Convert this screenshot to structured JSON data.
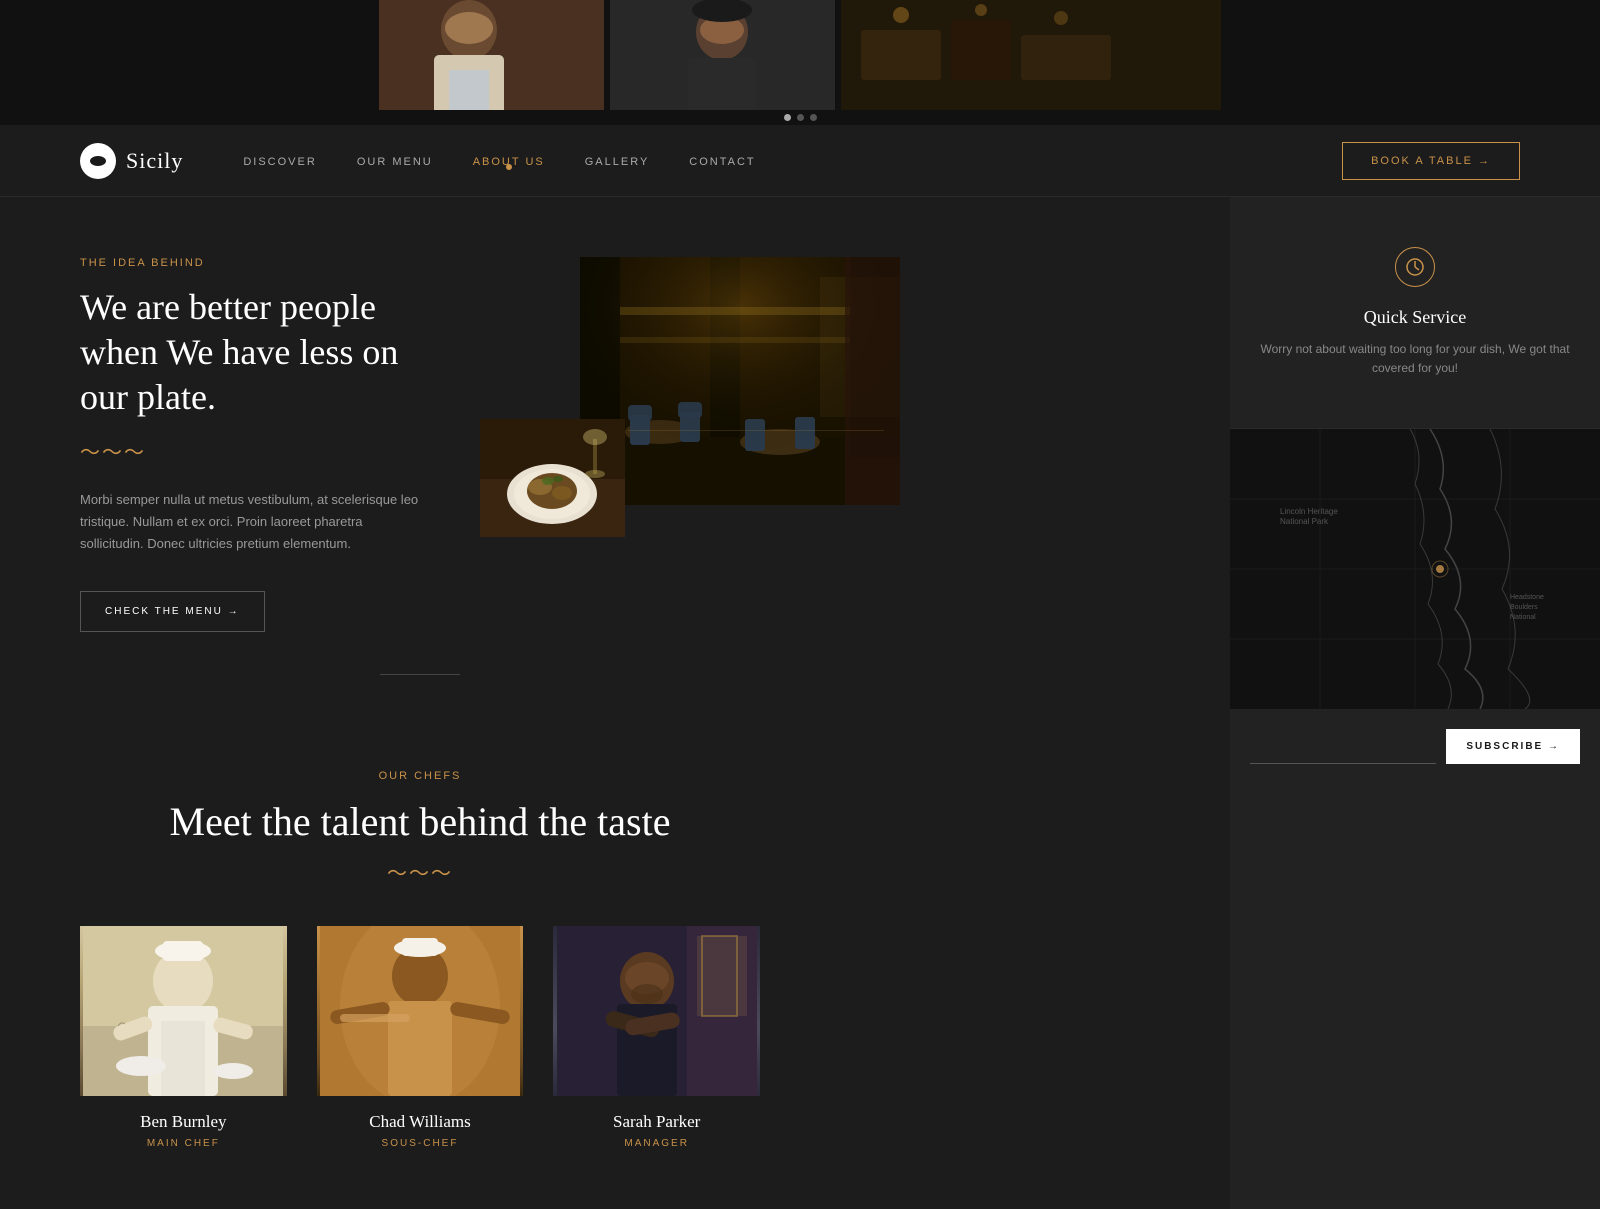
{
  "brand": {
    "logo_icon": "🥸",
    "name": "Sicily"
  },
  "hero": {
    "dots": [
      "active",
      "inactive",
      "inactive"
    ]
  },
  "nav": {
    "links": [
      {
        "id": "discover",
        "label": "DISCOVER",
        "active": false
      },
      {
        "id": "our-menu",
        "label": "OUR MENU",
        "active": false
      },
      {
        "id": "about-us",
        "label": "ABOUT US",
        "active": true
      },
      {
        "id": "gallery",
        "label": "GALLERY",
        "active": false
      },
      {
        "id": "contact",
        "label": "CONTACT",
        "active": false
      }
    ],
    "cta_label": "BOOK A TABLE →"
  },
  "about": {
    "section_label": "THE IDEA BEHIND",
    "headline": "We are better people when We have less on our plate.",
    "wave": "~~~",
    "body": "Morbi semper nulla ut metus vestibulum, at scelerisque leo tristique. Nullam et ex orci. Proin laoreet pharetra sollicitudin. Donec ultricies pretium elementum.",
    "cta_label": "CHECK THE MENU →"
  },
  "quick_service": {
    "icon": "⏱",
    "title": "Quick Service",
    "body": "Worry not about waiting too long for your dish, We got that covered for you!"
  },
  "subscribe": {
    "placeholder": "",
    "button_label": "SUBSCRIBE →"
  },
  "chefs": {
    "section_label": "OUR CHEFS",
    "headline": "Meet the talent behind the taste",
    "wave": "~~~",
    "items": [
      {
        "name": "Ben Burnley",
        "role": "MAIN CHEF"
      },
      {
        "name": "Chad Williams",
        "role": "SOUS-CHEF"
      },
      {
        "name": "Sarah Parker",
        "role": "MANAGER"
      }
    ]
  }
}
